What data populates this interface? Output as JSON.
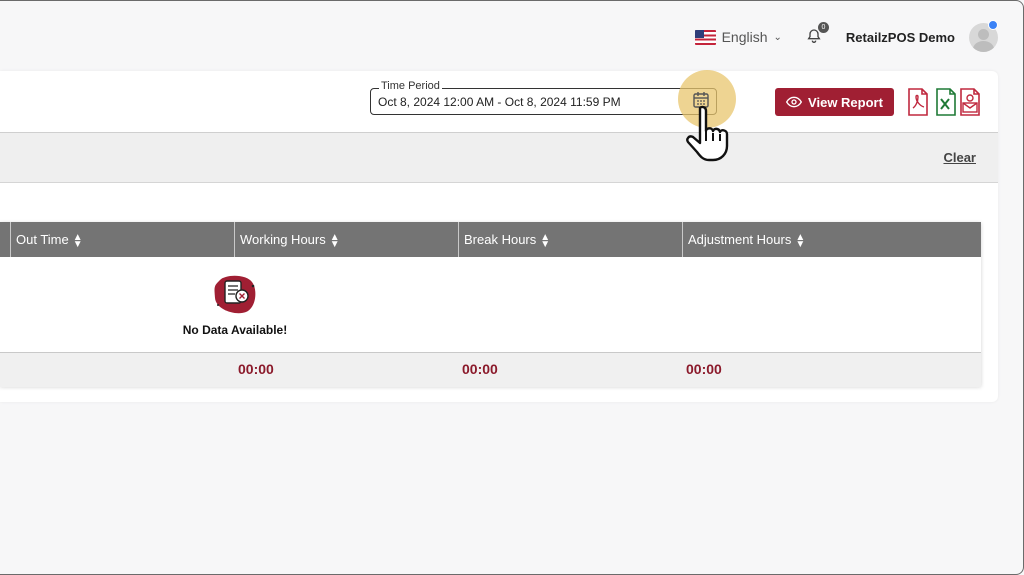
{
  "header": {
    "language": "English",
    "notification_count": "0",
    "username": "RetailzPOS Demo"
  },
  "toolbar": {
    "time_period_label": "Time Period",
    "time_period_value": "Oct 8, 2024 12:00 AM - Oct 8, 2024 11:59 PM",
    "view_report_label": "View Report",
    "export_icons": [
      "pdf-export-icon",
      "excel-export-icon",
      "email-export-icon"
    ]
  },
  "filters": {
    "clear_label": "Clear"
  },
  "table": {
    "columns": [
      "Out Time",
      "Working Hours",
      "Break Hours",
      "Adjustment Hours"
    ],
    "empty_message": "No Data Available!",
    "totals": [
      "00:00",
      "00:00",
      "00:00"
    ]
  },
  "colors": {
    "accent": "#a01f33",
    "header_bg": "#747474",
    "total_text": "#8b1a2b",
    "highlight": "#e8c56e"
  }
}
